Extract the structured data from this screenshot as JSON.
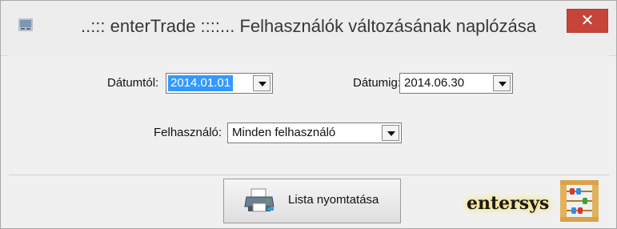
{
  "window": {
    "title": "..::: enterTrade ::::... Felhasználók változásának naplózása",
    "close_icon": "close-icon"
  },
  "form": {
    "date_from_label": "Dátumtól:",
    "date_from_value": "2014.01.01",
    "date_to_label": "Dátumig:",
    "date_to_value": "2014.06.30",
    "user_label": "Felhasználó:",
    "user_value": "Minden felhasználó"
  },
  "footer": {
    "print_label": "Lista nyomtatása",
    "print_icon": "printer-icon",
    "brand": "entersys",
    "brand_icon": "abacus-icon"
  },
  "colors": {
    "close": "#c7443a",
    "selection": "#3399ff",
    "field_bg": "#ffffff"
  }
}
